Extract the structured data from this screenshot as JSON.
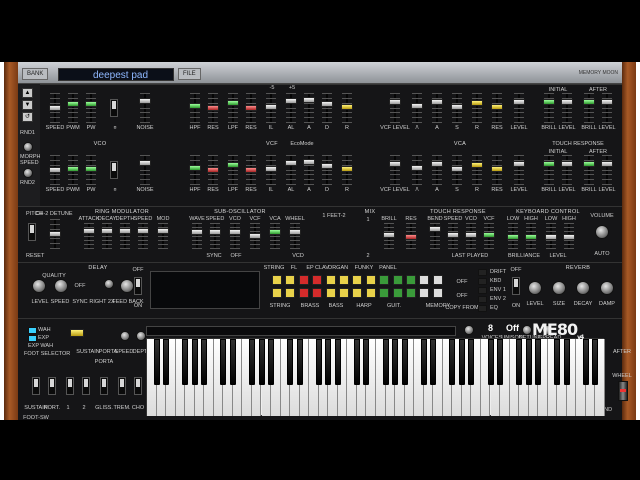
{
  "header": {
    "bank_label": "BANK",
    "preset_name": "deepest pad",
    "file_label": "FILE",
    "brand": "MEMORY MOON"
  },
  "side": {
    "rnd1": "RND1",
    "morph_speed": "MORPH SPEED",
    "rnd2": "RND2"
  },
  "vco": {
    "title": "VCO",
    "labels": [
      "SPEED",
      "PWM",
      "PW",
      "¤",
      "NOISE"
    ],
    "sub_labels": [
      "ON"
    ]
  },
  "vcf": {
    "title": "VCF",
    "ecomode": "EcoMode",
    "scale_labels": [
      "-5",
      "+5"
    ],
    "labels": [
      "HPF",
      "RES",
      "LPF",
      "RES",
      "IL",
      "AL",
      "A",
      "D",
      "R"
    ]
  },
  "vca": {
    "title": "VCA",
    "labels": [
      "VCF LEVEL",
      "/\\",
      "A",
      "S",
      "R",
      "RES",
      "LEVEL"
    ]
  },
  "initial_after": {
    "initial": "INITIAL",
    "after": "AFTER",
    "touch_response": "TOUCH RESPONSE",
    "labels": [
      "BRILL",
      "LEVEL",
      "BRILL",
      "LEVEL"
    ]
  },
  "mid": {
    "pitch": "PITCH",
    "ch2_detune": "CH-2 DETUNE",
    "reset": "RESET",
    "ring_mod_title": "RING MODULATOR",
    "ring_mod_labels": [
      "ATTACK",
      "DECAY",
      "DEPTH",
      "SPEED",
      "MOD"
    ],
    "sub_osc_title": "SUB-OSCILLATOR",
    "sub_osc_labels": [
      "WAVE",
      "SPEED",
      "VCO",
      "VCF",
      "VCA",
      "WHEEL"
    ],
    "sync_label": "SYNC",
    "off_label": "OFF",
    "vcd_label": "VCD",
    "feet_label": "1 FEET-2",
    "mix_title": "MIX",
    "mix_scale": [
      "1",
      "2"
    ],
    "mix_labels": [
      "BRILL",
      "RES"
    ],
    "touch_title": "TOUCH RESPONSE",
    "touch_labels": [
      "BEND",
      "SPEED",
      "VCO",
      "VCF"
    ],
    "last_played": "LAST PLAYED",
    "kb_control_title": "KEYBOARD CONTROL",
    "kb_labels": [
      "LOW",
      "HIGH",
      "LOW",
      "HIGH"
    ],
    "brilliance": "BRILLIANCE",
    "level": "LEVEL",
    "volume": "VOLUME",
    "auto": "AUTO"
  },
  "delay": {
    "title": "DELAY",
    "labels": [
      "LEVEL",
      "SPEED",
      "SYNC",
      "RIGHT 2X",
      "FEED BACK"
    ],
    "quality": "QUALITY",
    "off_label": "OFF",
    "on_label": "ON"
  },
  "presets": {
    "top_labels": [
      "STRING",
      "FL",
      "EP",
      "CLAV",
      "ORGAN",
      "FUNKY",
      "PANEL"
    ],
    "bottom_labels": [
      "STRING",
      "BRASS",
      "BASS",
      "HARP",
      "GUIT.",
      "MEMORY"
    ],
    "copy_from": "COPY FROM",
    "off1": "OFF",
    "off2": "OFF"
  },
  "routing": {
    "labels": [
      "DRIFT",
      "KBD",
      "ENV 1",
      "ENV 2",
      "EQ"
    ]
  },
  "reverb": {
    "title": "REVERB",
    "labels": [
      "LEVEL",
      "SIZE",
      "DECAY",
      "DAMP"
    ],
    "off": "OFF",
    "on": "ON"
  },
  "bottom": {
    "wah": "WAH",
    "exp": "EXP",
    "exp_wah": "EXP WAH",
    "foot_selector": "FOOT SELECTOR",
    "sustain": "SUSTAIN",
    "porta": "PORTA",
    "speed": "SPEED",
    "depth": "DEPTH",
    "porta2": "PORTA",
    "bottom_labels": [
      "SUSTAIN",
      "PORT.",
      "FOOT-SW",
      "1",
      "2",
      "GLISS.",
      "TREM.",
      "CHO",
      "ON"
    ]
  },
  "display": {
    "voices_value": "8",
    "voices_label": "VOICES",
    "unison_value": "Off",
    "unison_label": "UNISON",
    "detune": "DETUNE",
    "spread": "SPREAD",
    "logo": "ME80",
    "logo_suffix": "v4"
  },
  "right_panel": {
    "after": "AFTER",
    "wheel": "WHEEL",
    "kbd_bend": "KBD BEND"
  }
}
